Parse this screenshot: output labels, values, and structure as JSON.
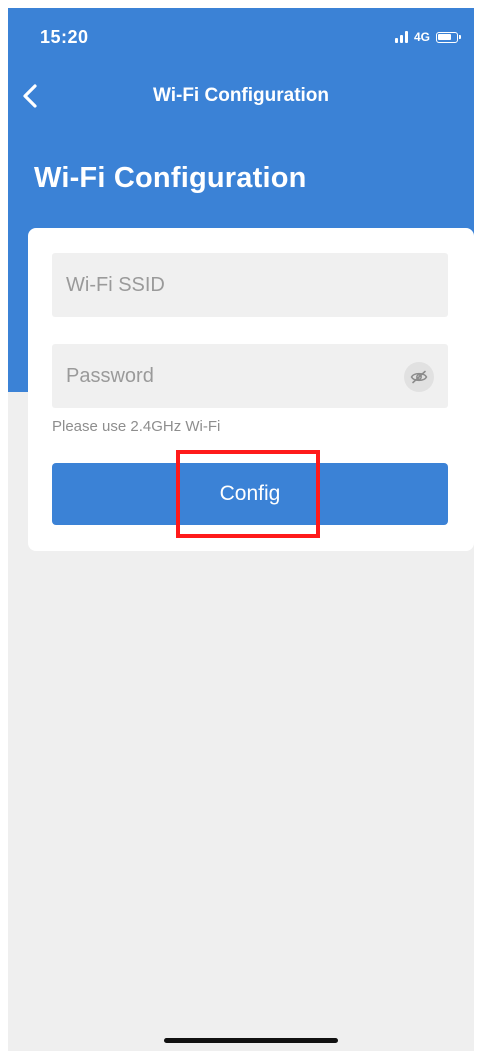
{
  "status_bar": {
    "time": "15:20",
    "network": "4G",
    "icons": [
      "signal-icon",
      "battery-icon"
    ]
  },
  "nav": {
    "title": "Wi-Fi Configuration",
    "back_icon": "chevron-left-icon"
  },
  "page": {
    "title": "Wi-Fi Configuration"
  },
  "form": {
    "ssid": {
      "placeholder": "Wi-Fi SSID",
      "value": ""
    },
    "password": {
      "placeholder": "Password",
      "value": "",
      "toggle_icon": "eye-off-icon"
    },
    "hint": "Please use 2.4GHz Wi-Fi",
    "submit_label": "Config"
  },
  "colors": {
    "primary": "#3b82d6",
    "background": "#efefef",
    "highlight": "#ff1a1a"
  }
}
